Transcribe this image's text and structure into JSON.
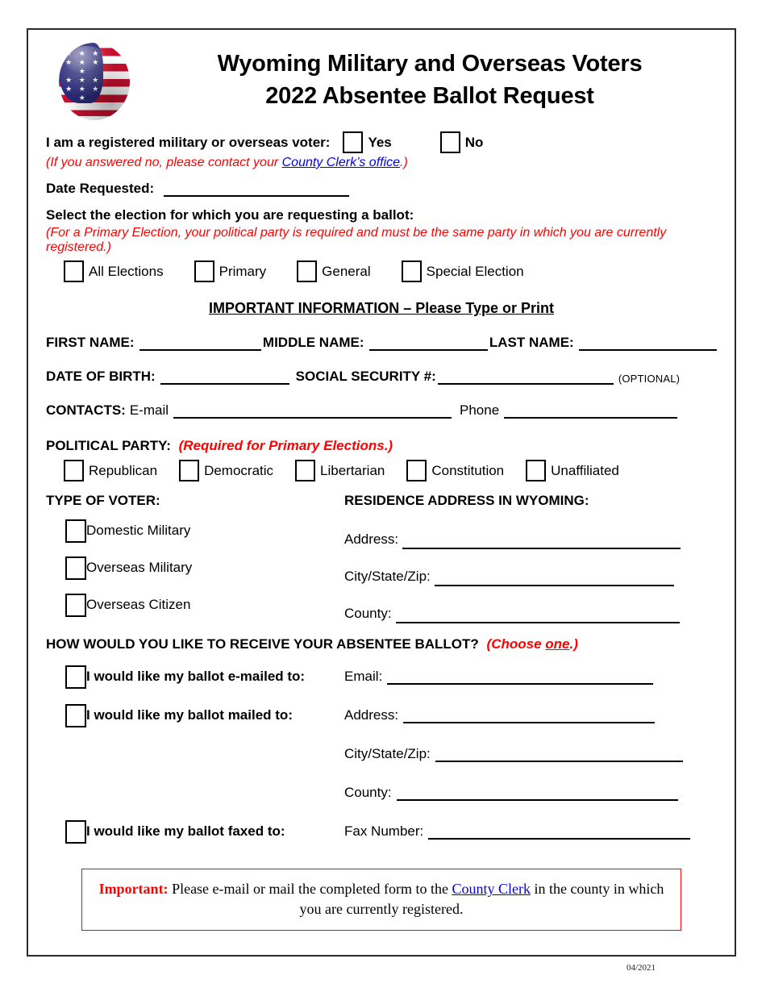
{
  "header": {
    "logo": "usa-flag-sphere-icon",
    "title_line1": "Wyoming Military and Overseas Voters",
    "title_line2": "2022 Absentee Ballot Request"
  },
  "registered_voter": {
    "question": "I am a registered military or overseas voter:",
    "yes_label": "Yes",
    "no_label": "No",
    "note_prefix": "(If you answered no, please contact your ",
    "note_link": "County Clerk’s office",
    "note_suffix": ".)"
  },
  "date_requested": {
    "label": "Date Requested",
    "colon": ":",
    "value": ""
  },
  "election_section": {
    "heading": "Select the election for which you are requesting a ballot:",
    "note": "(For a Primary Election, your political party is required and must be the same party in which you are currently registered.)",
    "options": [
      {
        "label": "All Elections",
        "checked": false
      },
      {
        "label": "Primary",
        "checked": false
      },
      {
        "label": "General",
        "checked": false
      },
      {
        "label": "Special Election",
        "checked": false
      }
    ]
  },
  "important_info": {
    "heading": "IMPORTANT INFORMATION – Please Type or Print"
  },
  "name_fields": {
    "first_label": "FIRST NAME:",
    "first_value": "",
    "middle_label": "MIDDLE NAME:",
    "middle_value": "",
    "last_label": "LAST NAME:",
    "last_value": ""
  },
  "identity_fields": {
    "dob_label": "DATE OF BIRTH:",
    "dob_value": "",
    "ssn_label": "SOCIAL SECURITY #",
    "ssn_colon": ":",
    "ssn_value": "",
    "optional_note": "(OPTIONAL)"
  },
  "contacts": {
    "label": "CONTACTS:",
    "email_label": "E-mail",
    "email_value": "",
    "phone_label": "Phone",
    "phone_value": ""
  },
  "political_party": {
    "label": "POLITICAL PARTY:",
    "note": "(Required for Primary Elections.)",
    "options": [
      {
        "label": "Republican",
        "checked": false
      },
      {
        "label": "Democratic",
        "checked": false
      },
      {
        "label": "Libertarian",
        "checked": false
      },
      {
        "label": "Constitution",
        "checked": false
      },
      {
        "label": "Unaffiliated",
        "checked": false
      }
    ]
  },
  "voter_type": {
    "heading": "TYPE OF VOTER:",
    "options": [
      {
        "label": "Domestic Military",
        "checked": false
      },
      {
        "label": "Overseas Military",
        "checked": false
      },
      {
        "label": "Overseas Citizen",
        "checked": false
      }
    ]
  },
  "residence_address": {
    "heading": "RESIDENCE ADDRESS IN WYOMING:",
    "fields": [
      {
        "label": "Address:",
        "value": ""
      },
      {
        "label": "City/State/Zip:",
        "value": ""
      },
      {
        "label": "County:",
        "value": ""
      }
    ]
  },
  "delivery": {
    "heading": "HOW WOULD YOU LIKE TO RECEIVE YOUR ABSENTEE BALLOT?",
    "note_prefix": "(Choose ",
    "note_underlined": "one",
    "note_suffix": ".)",
    "email_option": {
      "label": "I would like my ballot e-mailed to:",
      "checked": false
    },
    "email_field": {
      "label": "Email:",
      "value": ""
    },
    "mail_option": {
      "label": "I would like my ballot mailed to:",
      "checked": false
    },
    "mail_fields": [
      {
        "label": "Address:",
        "value": ""
      },
      {
        "label": "City/State/Zip:",
        "value": ""
      },
      {
        "label": "County:",
        "value": ""
      }
    ],
    "fax_option": {
      "label": "I would like my ballot faxed to:",
      "checked": false
    },
    "fax_field": {
      "label": "Fax Number:",
      "value": ""
    }
  },
  "important_box": {
    "word": "Important:",
    "text_before_link": " Please e-mail or mail the completed form to the ",
    "link": "County Clerk",
    "text_after_link": " in the county in which you are currently registered."
  },
  "footer": {
    "revision_date": "04/2021"
  },
  "colors": {
    "red": "#ff0000",
    "link_blue": "#0000ee",
    "border_gray": "#2b2b2b",
    "flag_blue": "#2a2a7a",
    "flag_red": "#c8102e"
  }
}
